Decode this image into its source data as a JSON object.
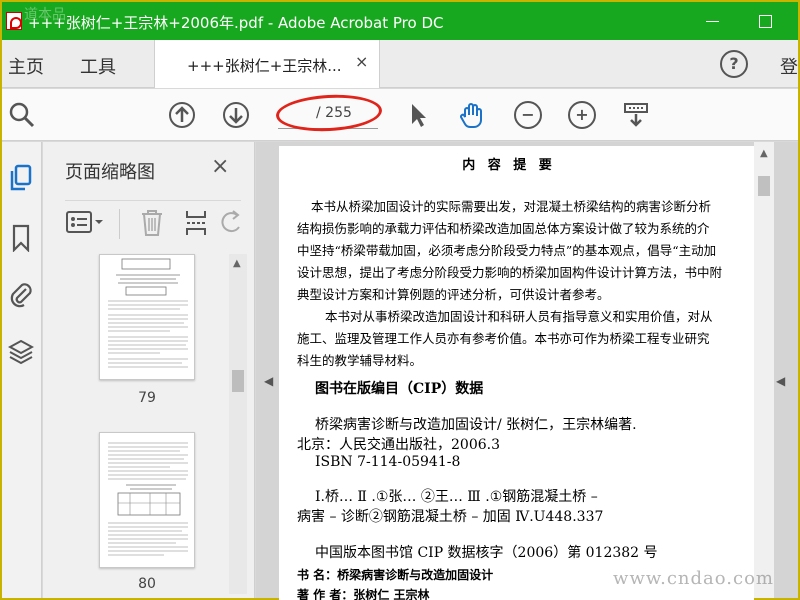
{
  "window": {
    "title": "+++张树仁+王宗林+2006年.pdf - Adobe Acrobat Pro DC",
    "watermark_top": "道本品"
  },
  "tabbar": {
    "home": "主页",
    "tools": "工具",
    "doc_tab": "+++张树仁+王宗林...",
    "close": "×",
    "help": "?",
    "login": "登"
  },
  "toolbar": {
    "page_current": "",
    "page_total": "/ 255",
    "highlight_color": "#e0241a"
  },
  "thumbnails": {
    "panel_title": "页面缩略图",
    "close": "×",
    "pages": [
      {
        "number": "79"
      },
      {
        "number": "80"
      }
    ]
  },
  "document": {
    "heading": "内 容 提 要",
    "lines": [
      "本书从桥梁加固设计的实际需要出发，对混凝土桥梁结构的病害诊断分析",
      "结构损伤影响的承载力评估和桥梁改造加固总体方案设计做了较为系统的介",
      "中坚持“桥梁带载加固，必须考虑分阶段受力特点”的基本观点，倡导“主动加",
      "设计思想，提出了考虑分阶段受力影响的桥梁加固构件设计计算方法，书中附",
      "典型设计方案和计算例题的评述分析，可供设计者参考。",
      "本书对从事桥梁改造加固设计和科研人员有指导意义和实用价值，对从",
      "施工、监理及管理工作人员亦有参考价值。本书亦可作为桥梁工程专业研究",
      "科生的教学辅导材料。"
    ],
    "cip_title": "图书在版编目（CIP）数据",
    "cip_lines": [
      "桥梁病害诊断与改造加固设计/ 张树仁，王宗林编著.",
      "北京：人民交通出版社，2006.3",
      "ISBN 7-114-05941-8",
      "Ⅰ.桥…  Ⅱ  .①张…  ②王…    Ⅲ  .①钢筋混凝土桥 –",
      "病害 – 诊断②钢筋混凝土桥 – 加固    Ⅳ.U448.337",
      "中国版本图书馆 CIP 数据核字（2006）第 012382 号",
      "书      名：桥梁病害诊断与改造加固设计",
      "著  作  者：张树仁    王宗林"
    ],
    "site_watermark": "www.cndao.com"
  }
}
